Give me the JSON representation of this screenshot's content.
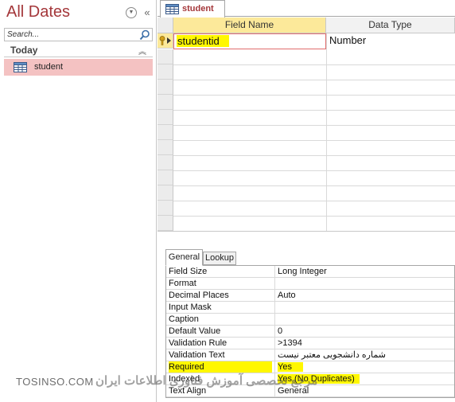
{
  "nav": {
    "title": "All Dates",
    "search_placeholder": "Search...",
    "group_label": "Today",
    "items": [
      {
        "label": "student"
      }
    ]
  },
  "doc": {
    "tab_label": "student"
  },
  "grid": {
    "headers": {
      "field_name": "Field Name",
      "data_type": "Data Type"
    },
    "rows": [
      {
        "field_name": "studentid",
        "data_type": "Number",
        "primary_key": true
      }
    ]
  },
  "props": {
    "tabs": [
      "General",
      "Lookup"
    ],
    "rows": [
      {
        "name": "Field Size",
        "value": "Long Integer"
      },
      {
        "name": "Format",
        "value": ""
      },
      {
        "name": "Decimal Places",
        "value": "Auto"
      },
      {
        "name": "Input Mask",
        "value": ""
      },
      {
        "name": "Caption",
        "value": ""
      },
      {
        "name": "Default Value",
        "value": "0"
      },
      {
        "name": "Validation Rule",
        "value": ">1394"
      },
      {
        "name": "Validation Text",
        "value": "شماره دانشجویی معتبر نیست"
      },
      {
        "name": "Required",
        "value": "Yes"
      },
      {
        "name": "Indexed",
        "value": "Yes (No Duplicates)"
      },
      {
        "name": "Text Align",
        "value": "General"
      }
    ]
  },
  "watermark": {
    "site": "TOSINSO.COM",
    "text_fa": "مرجع تخصصی آموزش فناوری اطلاعات ایران"
  },
  "colors": {
    "accent": "#a4373a",
    "highlight": "#fff700",
    "selected_item": "#f4c2c2"
  }
}
